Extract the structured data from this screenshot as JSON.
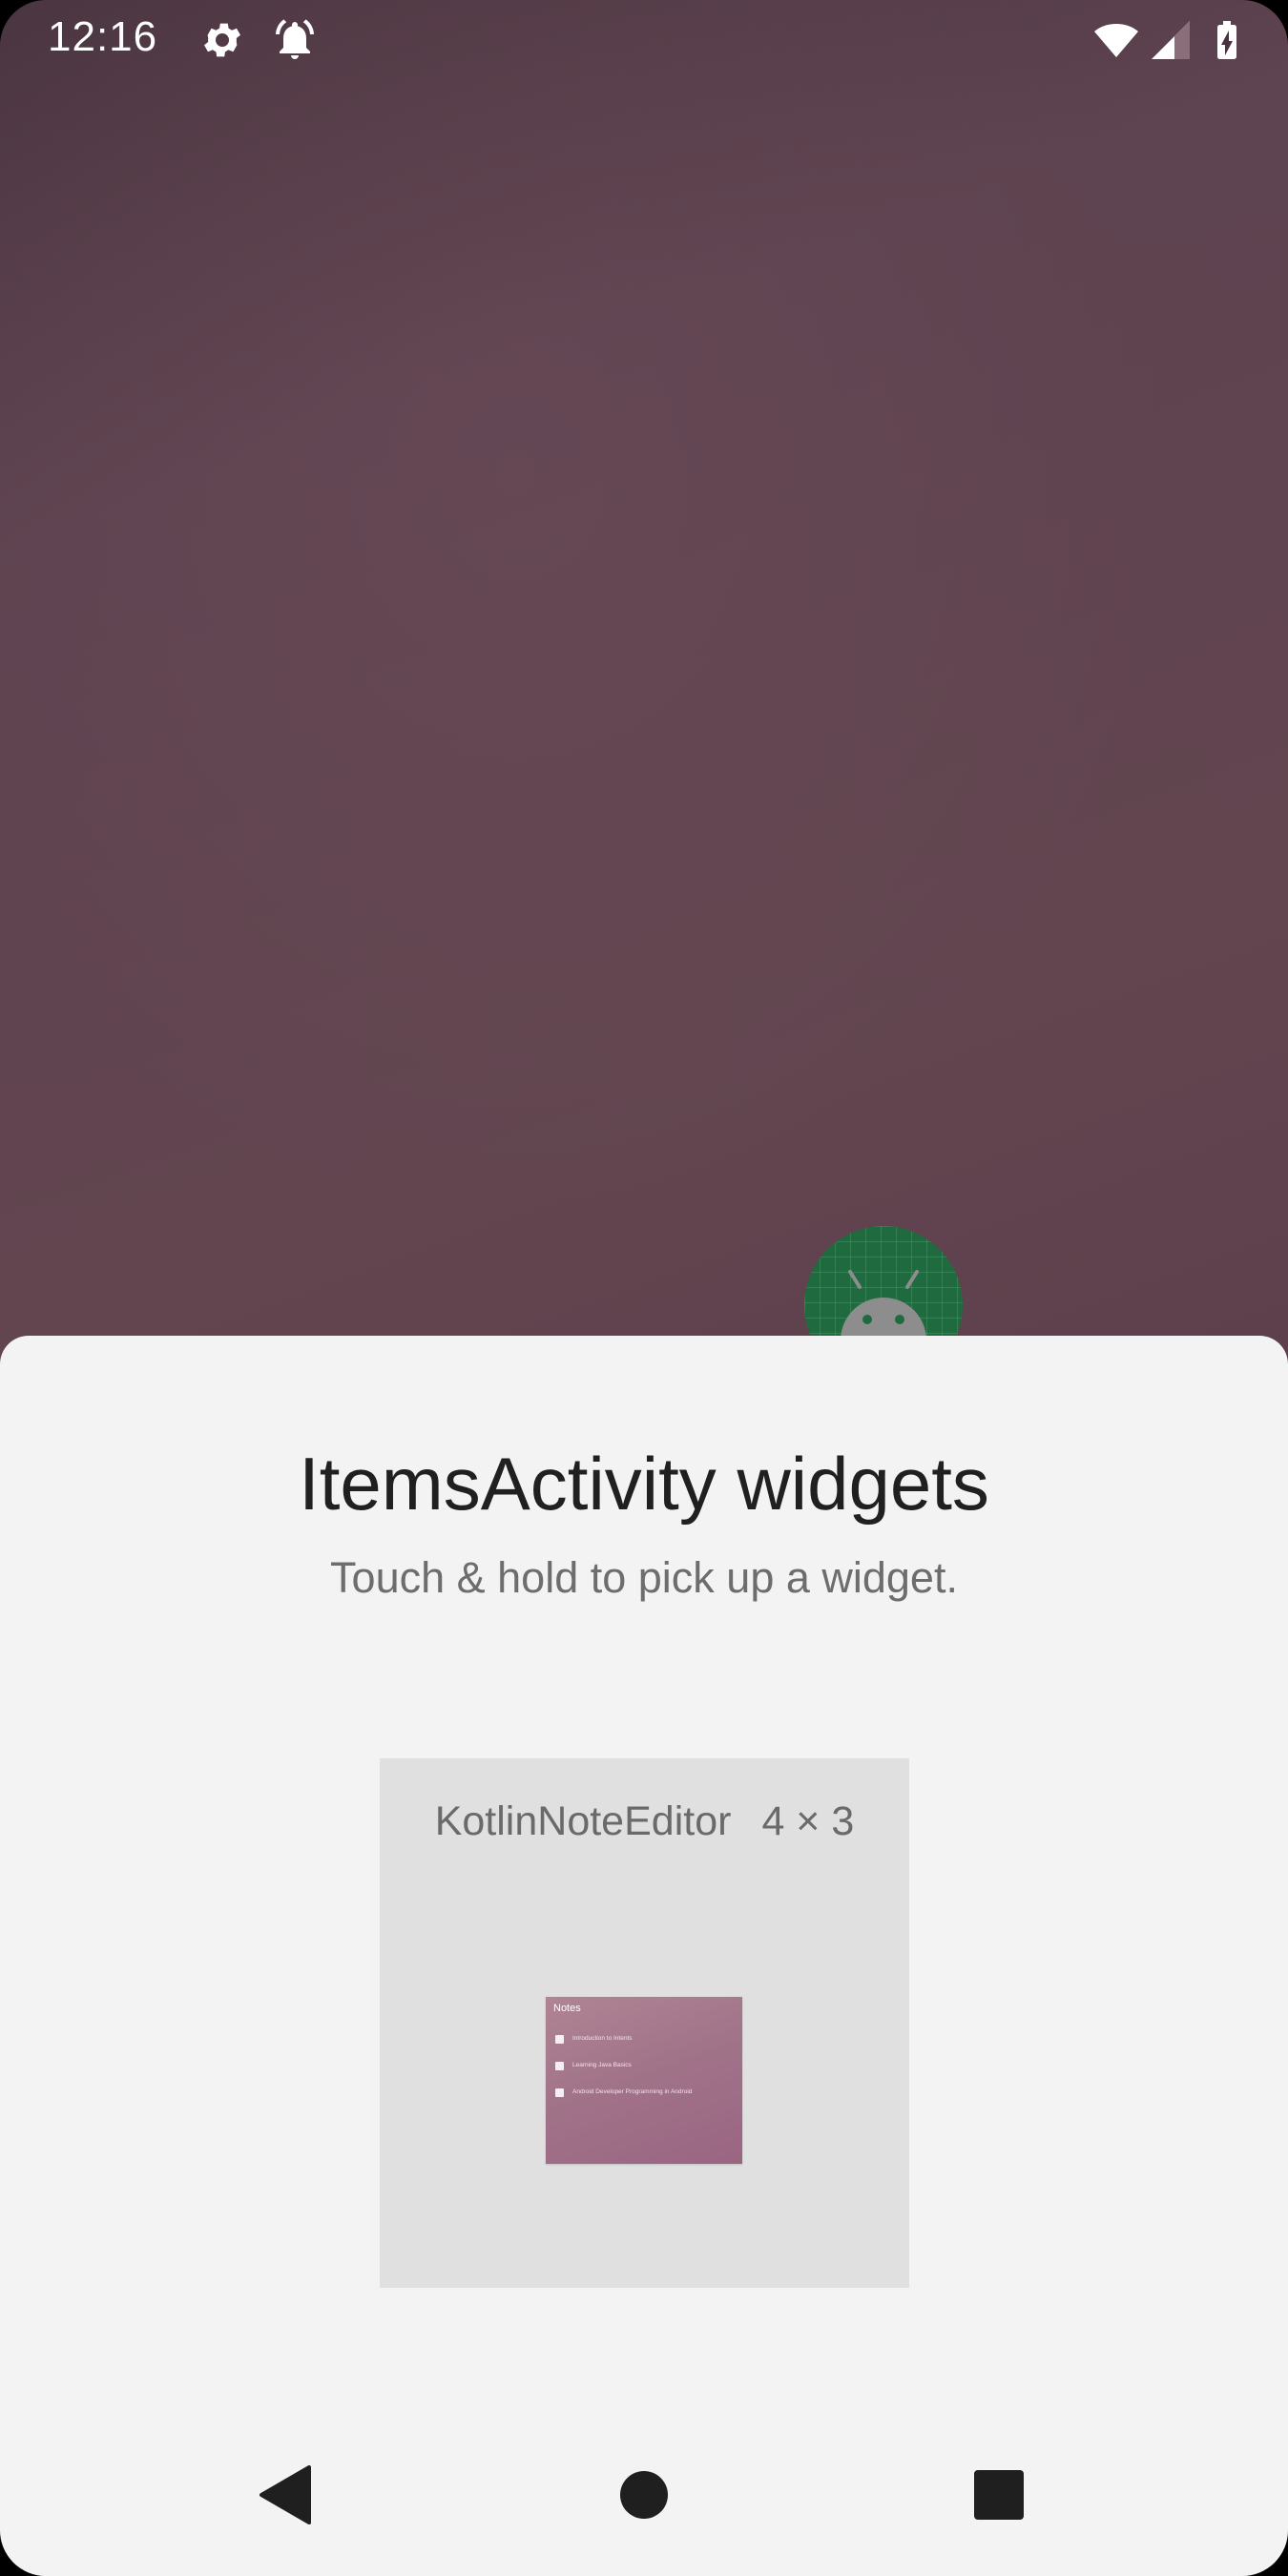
{
  "status_bar": {
    "time": "12:16",
    "left_icons": [
      "gear-icon",
      "alarm-icon"
    ],
    "right_icons": [
      "wifi-icon",
      "cell-signal-icon",
      "battery-charging-icon"
    ]
  },
  "background": {
    "app_icon": "android-app-icon"
  },
  "sheet": {
    "title": "ItemsActivity widgets",
    "subtitle": "Touch & hold to pick up a widget.",
    "widget": {
      "name": "KotlinNoteEditor",
      "size": "4 × 3",
      "preview": {
        "title": "Notes",
        "items": [
          "Introduction to Intents",
          "Learning Java Basics",
          "Android Developer Programming in Android"
        ]
      }
    }
  },
  "nav_bar": {
    "buttons": [
      "back-icon",
      "home-icon",
      "recents-icon"
    ]
  },
  "colors": {
    "sheet_background": "#f3f3f3",
    "widget_card": "#e0e0e0",
    "app_icon_green": "#1f6a3f"
  }
}
